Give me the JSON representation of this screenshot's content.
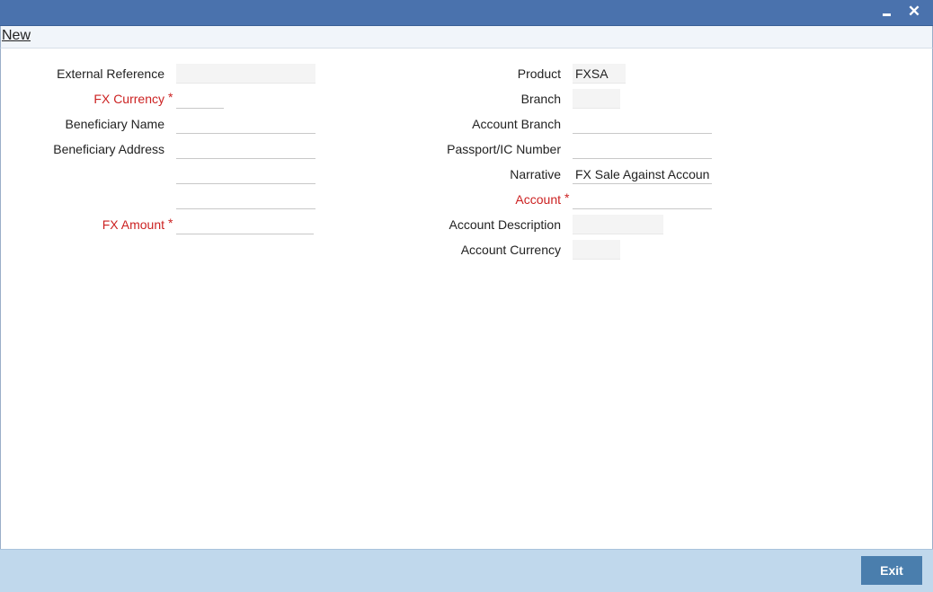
{
  "window": {
    "minimize_glyph": "",
    "close_glyph": "✕"
  },
  "toolbar": {
    "new_label": "New"
  },
  "left_fields": {
    "external_reference": {
      "label": "External Reference",
      "value": ""
    },
    "fx_currency": {
      "label": "FX Currency",
      "required_mark": "*",
      "value": ""
    },
    "beneficiary_name": {
      "label": "Beneficiary Name",
      "value": ""
    },
    "beneficiary_address": {
      "label": "Beneficiary Address",
      "lines": [
        "",
        "",
        ""
      ]
    },
    "fx_amount": {
      "label": "FX Amount",
      "required_mark": "*",
      "value": ""
    }
  },
  "right_fields": {
    "product": {
      "label": "Product",
      "value": "FXSA"
    },
    "branch": {
      "label": "Branch",
      "value": ""
    },
    "account_branch": {
      "label": "Account Branch",
      "value": ""
    },
    "passport_ic_number": {
      "label": "Passport/IC Number",
      "value": ""
    },
    "narrative": {
      "label": "Narrative",
      "value": "FX Sale Against Account"
    },
    "account": {
      "label": "Account",
      "required_mark": "*",
      "value": ""
    },
    "account_description": {
      "label": "Account Description",
      "value": ""
    },
    "account_currency": {
      "label": "Account Currency",
      "value": ""
    }
  },
  "footer": {
    "exit_label": "Exit"
  },
  "colors": {
    "titlebar": "#4a72ad",
    "required": "#cc2222",
    "footer": "#c0d8ec",
    "exit_button": "#4a7ead"
  }
}
